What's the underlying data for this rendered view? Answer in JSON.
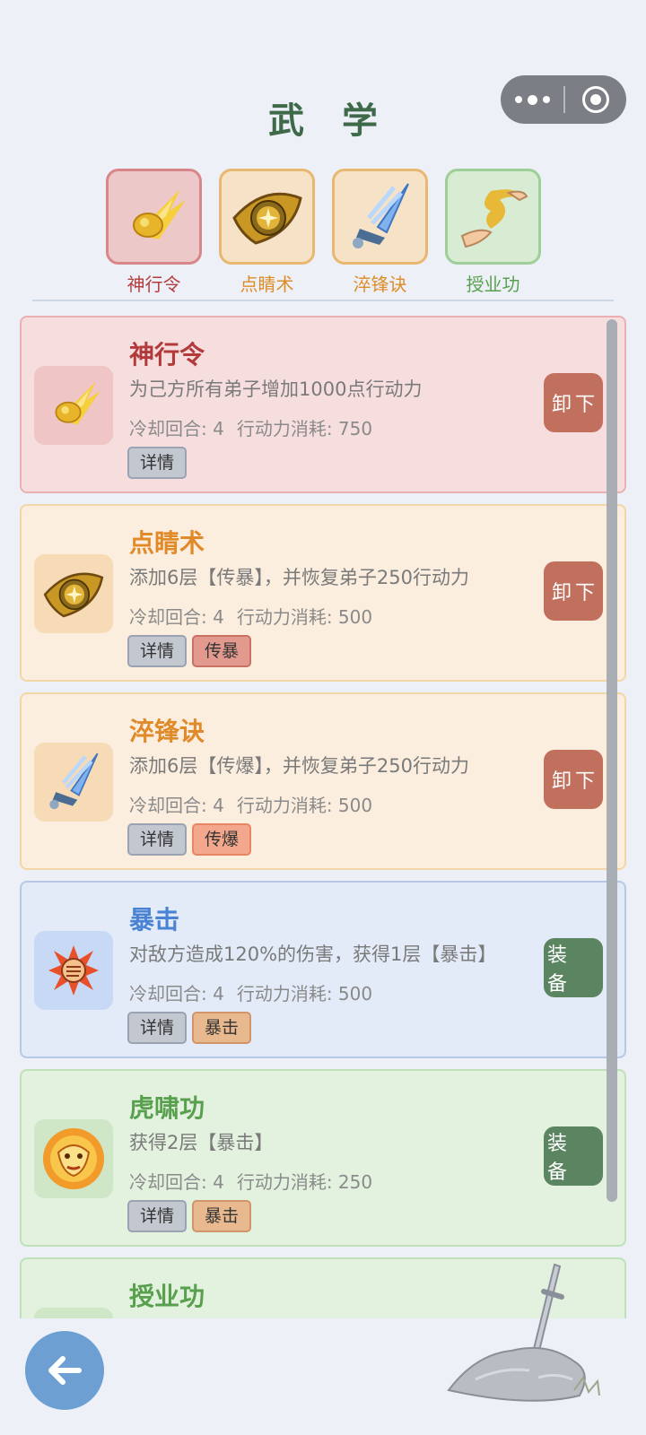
{
  "page": {
    "title": "武 学"
  },
  "equipped": [
    {
      "label": "神行令",
      "theme": "red",
      "icon": "golden-shoe-icon"
    },
    {
      "label": "点睛术",
      "theme": "orange",
      "icon": "golden-eye-icon"
    },
    {
      "label": "淬锋诀",
      "theme": "orange",
      "icon": "blue-sword-icon"
    },
    {
      "label": "授业功",
      "theme": "green",
      "icon": "golden-hands-icon"
    }
  ],
  "skills": [
    {
      "name": "神行令",
      "theme": "red",
      "icon": "golden-shoe-icon",
      "desc": "为己方所有弟子增加1000点行动力",
      "cooldown": "冷却回合: 4",
      "cost": "行动力消耗: 750",
      "tags": [
        {
          "label": "详情",
          "style": "detail"
        }
      ],
      "button": "卸下",
      "button_style": "unload"
    },
    {
      "name": "点睛术",
      "theme": "orange",
      "icon": "golden-eye-icon",
      "desc": "添加6层【传暴】，并恢复弟子250行动力",
      "cooldown": "冷却回合: 4",
      "cost": "行动力消耗: 500",
      "tags": [
        {
          "label": "详情",
          "style": "detail"
        },
        {
          "label": "传暴",
          "style": "red"
        }
      ],
      "button": "卸下",
      "button_style": "unload"
    },
    {
      "name": "淬锋诀",
      "theme": "orange",
      "icon": "blue-sword-icon",
      "desc": "添加6层【传爆】，并恢复弟子250行动力",
      "cooldown": "冷却回合: 4",
      "cost": "行动力消耗: 500",
      "tags": [
        {
          "label": "详情",
          "style": "detail"
        },
        {
          "label": "传爆",
          "style": "salmon"
        }
      ],
      "button": "卸下",
      "button_style": "unload"
    },
    {
      "name": "暴击",
      "theme": "blue",
      "icon": "critical-fist-icon",
      "desc": "对敌方造成120%的伤害，获得1层【暴击】",
      "cooldown": "冷却回合: 4",
      "cost": "行动力消耗: 500",
      "tags": [
        {
          "label": "详情",
          "style": "detail"
        },
        {
          "label": "暴击",
          "style": "amber"
        }
      ],
      "button": "装 备",
      "button_style": "equip"
    },
    {
      "name": "虎啸功",
      "theme": "green",
      "icon": "flaming-tiger-icon",
      "desc": "获得2层【暴击】",
      "cooldown": "冷却回合: 4",
      "cost": "行动力消耗: 250",
      "tags": [
        {
          "label": "详情",
          "style": "detail"
        },
        {
          "label": "暴击",
          "style": "amber"
        }
      ],
      "button": "装 备",
      "button_style": "equip"
    },
    {
      "name": "授业功",
      "theme": "green",
      "icon": "golden-hands-icon",
      "desc": "",
      "cooldown": "",
      "cost": "",
      "tags": [],
      "button": "",
      "button_style": "unload"
    }
  ],
  "footer": {
    "back_icon": "back-arrow-icon",
    "decoration": "sword-in-stone-icon"
  }
}
